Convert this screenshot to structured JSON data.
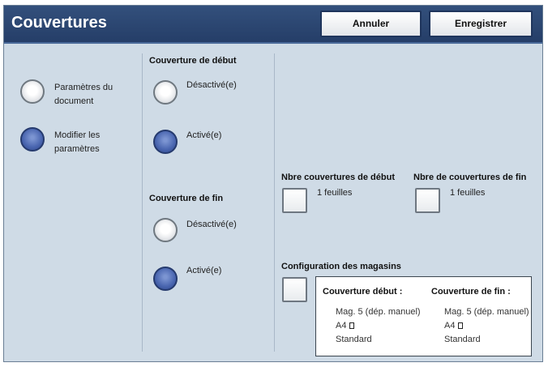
{
  "header": {
    "title": "Couvertures",
    "cancel_label": "Annuler",
    "save_label": "Enregistrer"
  },
  "left_options": {
    "doc_params_line1": "Paramètres du",
    "doc_params_line2": "document",
    "modify_line1": "Modifier les",
    "modify_line2": "paramètres",
    "selected": "modify"
  },
  "front_cover": {
    "heading": "Couverture de début",
    "off_label": "Désactivé(e)",
    "on_label": "Activé(e)",
    "selected": "on"
  },
  "back_cover": {
    "heading": "Couverture de fin",
    "off_label": "Désactivé(e)",
    "on_label": "Activé(e)",
    "selected": "on"
  },
  "counts": {
    "front_heading": "Nbre couvertures de début",
    "front_value": "1 feuilles",
    "back_heading": "Nbre de couvertures de fin",
    "back_value": "1 feuilles"
  },
  "trays": {
    "heading": "Configuration des magasins",
    "front_title": "Couverture début :",
    "back_title": "Couverture de fin :",
    "front_tray": "Mag. 5 (dép. manuel)",
    "front_size": "A4",
    "front_type": "Standard",
    "back_tray": "Mag. 5 (dép. manuel)",
    "back_size": "A4",
    "back_type": "Standard",
    "paper_icon": "portrait-paper-icon"
  }
}
